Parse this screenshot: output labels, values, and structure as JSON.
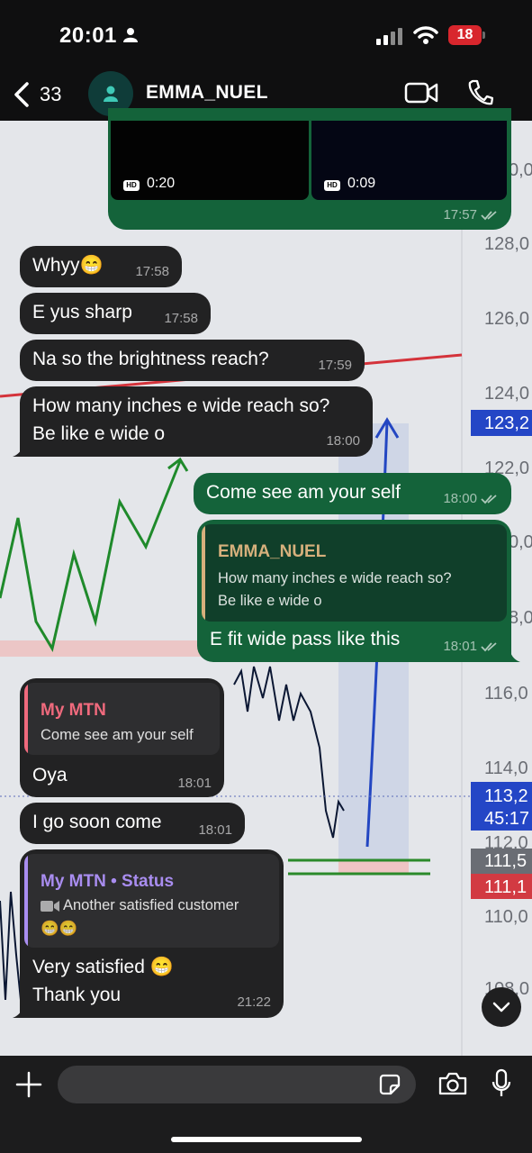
{
  "status_bar": {
    "time": "20:01",
    "battery": "18"
  },
  "header": {
    "back_count": "33",
    "contact_name": "EMMA_NUEL"
  },
  "background_chart": {
    "price_labels": [
      "0,0",
      "128,0",
      "126,0",
      "124,0",
      "123,2",
      "122,0",
      "0,0",
      "8,0",
      "116,0",
      "114,0",
      "113,2",
      "45:17",
      "112,0",
      "111,5",
      "111,1",
      "110,0",
      "108,0"
    ]
  },
  "videos": [
    {
      "duration": "0:20",
      "badge": "HD"
    },
    {
      "duration": "0:09",
      "badge": "HD"
    }
  ],
  "messages": [
    {
      "id": "m0",
      "dir": "out",
      "time": "17:57"
    },
    {
      "id": "m1",
      "dir": "in",
      "text": "Whyy😁",
      "time": "17:58"
    },
    {
      "id": "m2",
      "dir": "in",
      "text": "E yus sharp",
      "time": "17:58"
    },
    {
      "id": "m3",
      "dir": "in",
      "text": "Na so the brightness reach?",
      "time": "17:59"
    },
    {
      "id": "m4",
      "dir": "in",
      "lines": [
        "How many inches e wide reach so?",
        "Be like e wide o"
      ],
      "time": "18:00"
    },
    {
      "id": "m5",
      "dir": "out",
      "text": "Come see am your self",
      "time": "18:00"
    },
    {
      "id": "m6",
      "dir": "out",
      "quote": {
        "name": "EMMA_NUEL",
        "lines": [
          "How many inches e wide reach so?",
          "Be like e wide o"
        ]
      },
      "text": "E fit wide pass like this",
      "time": "18:01"
    },
    {
      "id": "m7",
      "dir": "in",
      "quote": {
        "name": "My MTN",
        "text": "Come see am your self"
      },
      "text": "Oya",
      "time": "18:01"
    },
    {
      "id": "m8",
      "dir": "in",
      "text": "I go soon come",
      "time": "18:01"
    },
    {
      "id": "m9",
      "dir": "in",
      "quote": {
        "name": "My MTN • Status",
        "text": "Another satisfied customer",
        "emoji": "😁😁"
      },
      "lines": [
        "Very satisfied 😁",
        "Thank you"
      ],
      "time": "21:22"
    }
  ],
  "colors": {
    "incoming_bubble": "#222223",
    "outgoing_bubble": "#14633a",
    "quote_emma": "#d6b07c",
    "quote_mtn": "#f06a7d",
    "quote_status": "#a98df0"
  }
}
